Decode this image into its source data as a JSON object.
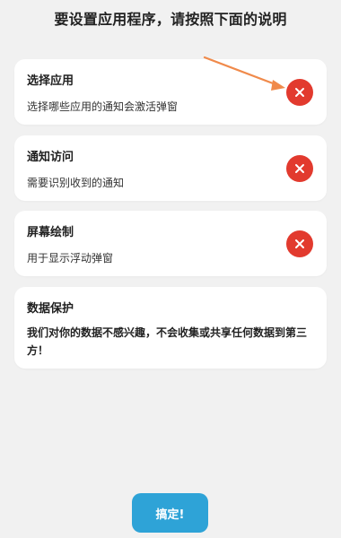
{
  "header": {
    "title": "要设置应用程序，请按照下面的说明"
  },
  "cards": [
    {
      "title": "选择应用",
      "description": "选择哪些应用的通知会激活弹窗",
      "status_icon": "close-icon"
    },
    {
      "title": "通知访问",
      "description": "需要识别收到的通知",
      "status_icon": "close-icon"
    },
    {
      "title": "屏幕绘制",
      "description": "用于显示浮动弹窗",
      "status_icon": "close-icon"
    },
    {
      "title": "数据保护",
      "description": "我们对你的数据不感兴趣，不会收集或共享任何数据到第三方！"
    }
  ],
  "confirm_button": {
    "label": "搞定!"
  },
  "colors": {
    "background": "#f1f1f1",
    "card": "#ffffff",
    "status_red": "#e23a2e",
    "accent_blue": "#2ea3d7",
    "annotation_arrow": "#f08a4b"
  }
}
